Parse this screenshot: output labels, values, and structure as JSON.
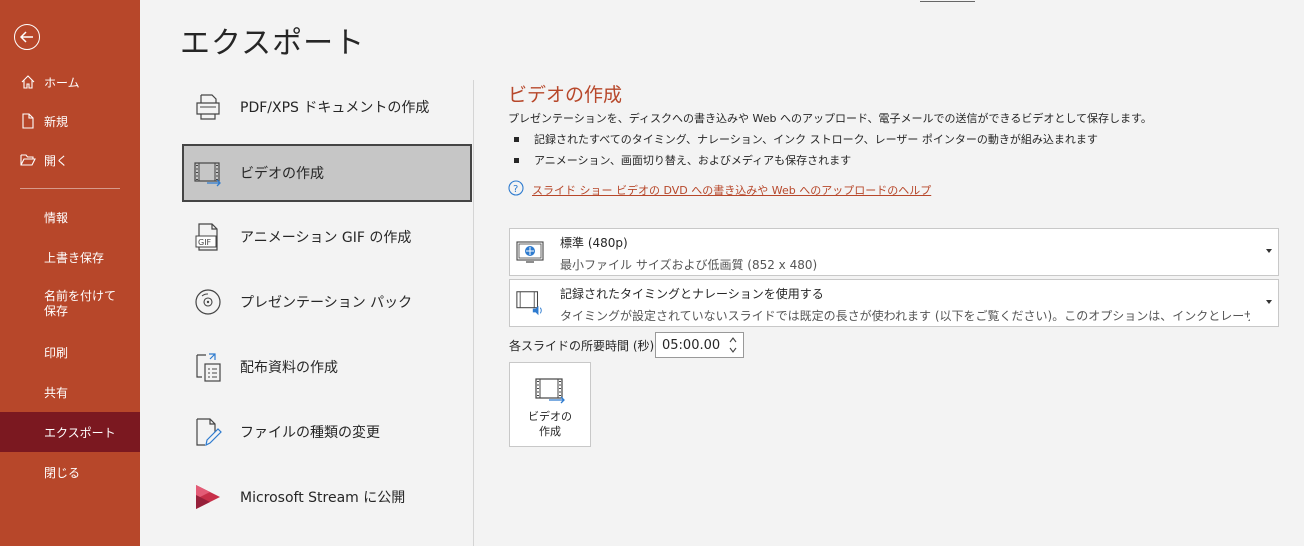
{
  "sidebar": {
    "back_icon": "back-arrow-icon",
    "items": [
      {
        "label": "ホーム",
        "icon": "home-icon"
      },
      {
        "label": "新規",
        "icon": "new-document-icon"
      },
      {
        "label": "開く",
        "icon": "open-folder-icon"
      },
      {
        "label": "情報"
      },
      {
        "label": "上書き保存"
      },
      {
        "label": "名前を付けて保存"
      },
      {
        "label": "印刷"
      },
      {
        "label": "共有"
      },
      {
        "label": "エクスポート",
        "active": true
      },
      {
        "label": "閉じる"
      }
    ],
    "bg_color": "#b7472a",
    "active_color": "#7b1820"
  },
  "page_title": "エクスポート",
  "export_options": [
    {
      "label": "PDF/XPS ドキュメントの作成",
      "icon": "pdf-printer-icon"
    },
    {
      "label": "ビデオの作成",
      "icon": "video-film-icon",
      "selected": true
    },
    {
      "label": "アニメーション GIF の作成",
      "icon": "gif-icon"
    },
    {
      "label": "プレゼンテーション パック",
      "icon": "cd-disc-icon"
    },
    {
      "label": "配布資料の作成",
      "icon": "handout-icon"
    },
    {
      "label": "ファイルの種類の変更",
      "icon": "change-filetype-icon"
    },
    {
      "label": "Microsoft Stream に公開",
      "icon": "stream-icon"
    }
  ],
  "detail": {
    "title": "ビデオの作成",
    "description": "プレゼンテーションを、ディスクへの書き込みや Web へのアップロード、電子メールでの送信ができるビデオとして保存します。",
    "bullets": [
      "記録されたすべてのタイミング、ナレーション、インク ストローク、レーザー ポインターの動きが組み込まれます",
      "アニメーション、画面切り替え、およびメディアも保存されます"
    ],
    "help_link": "スライド ショー ビデオの DVD への書き込みや Web へのアップロードのヘルプ",
    "quality_dropdown": {
      "line1": "標準 (480p)",
      "line2": "最小ファイル サイズおよび低画質 (852 x 480)"
    },
    "timing_dropdown": {
      "line1": "記録されたタイミングとナレーションを使用する",
      "line2": "タイミングが設定されていないスライドでは既定の長さが使われます (以下をご覧ください)。このオプションは、インクとレーザー ポインター…"
    },
    "duration_label": "各スライドの所要時間 (秒):",
    "duration_value": "05:00.00",
    "create_button": {
      "line1": "ビデオの",
      "line2": "作成"
    },
    "accent_color": "#b7472a"
  }
}
